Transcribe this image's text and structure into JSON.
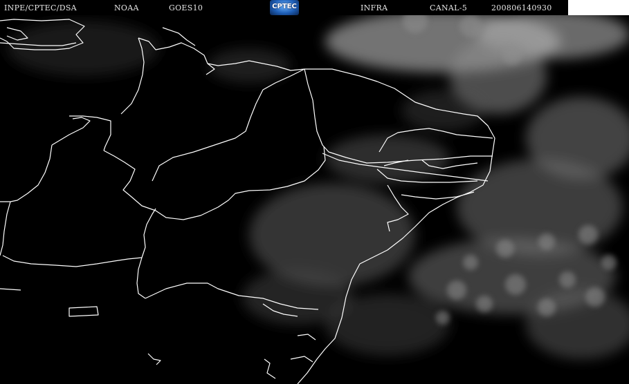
{
  "header": {
    "agency": "INPE/CPTEC/DSA",
    "source": "NOAA",
    "satellite": "GOES10",
    "logo_text": "CPTEC",
    "band_type": "INFRA",
    "channel": "CANAL-5",
    "timestamp": "200806140930"
  },
  "colors": {
    "background": "#000000",
    "boundaries": "#ffffff",
    "clouds": "#8a8a8a",
    "logo_accent": "#1e5fb8"
  }
}
